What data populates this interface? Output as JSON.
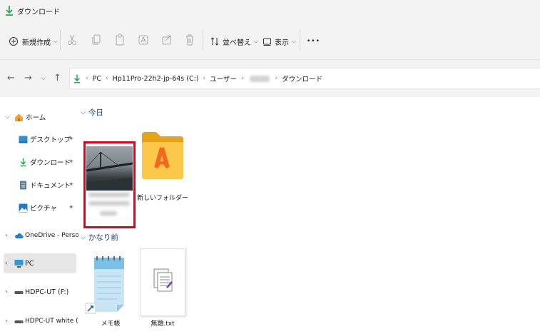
{
  "window": {
    "title": "ダウンロード"
  },
  "toolbar": {
    "new_label": "新規作成",
    "sort_label": "並べ替え",
    "view_label": "表示",
    "more_label": "•••"
  },
  "address": {
    "crumbs": [
      "PC",
      "Hp11Pro-22h2-jp-64s (C:)",
      "ユーザー",
      "ダウンロード"
    ]
  },
  "sidebar": {
    "items": [
      {
        "label": "ホーム"
      },
      {
        "label": "デスクトップ"
      },
      {
        "label": "ダウンロード"
      },
      {
        "label": "ドキュメント"
      },
      {
        "label": "ピクチャ"
      },
      {
        "label": "OneDrive - Personal"
      },
      {
        "label": "PC"
      },
      {
        "label": "HDPC-UT (F:)"
      },
      {
        "label": "HDPC-UT white (K:)"
      }
    ]
  },
  "content": {
    "groups": [
      {
        "label": "今日"
      },
      {
        "label": "かなり前"
      }
    ],
    "files": [
      {
        "label": "新しいフォルダー"
      },
      {
        "label": "メモ帳"
      },
      {
        "label": "無題.txt"
      }
    ]
  }
}
